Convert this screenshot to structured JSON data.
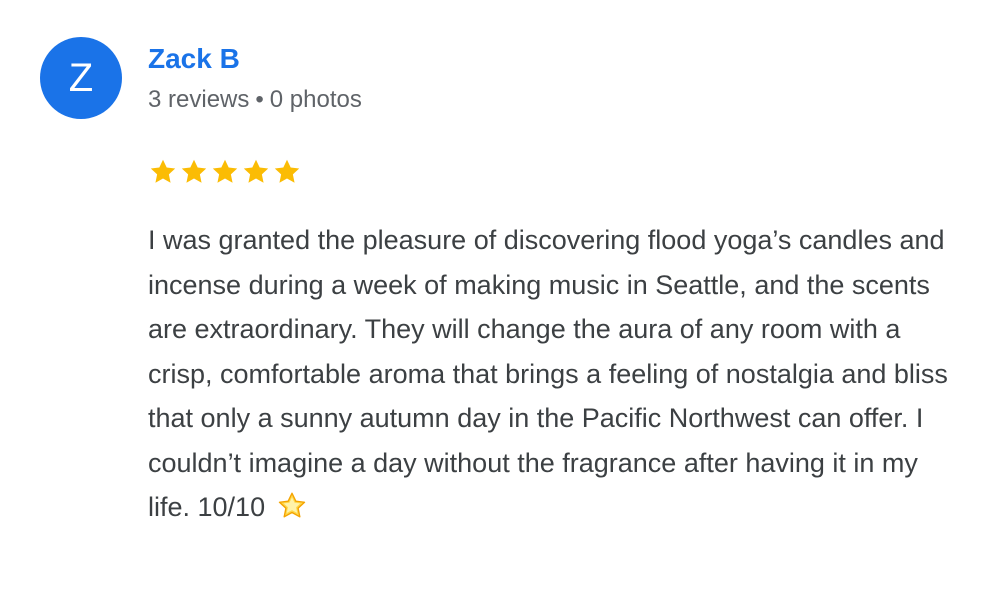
{
  "reviewer": {
    "initial": "Z",
    "name": "Zack B",
    "reviews": "3 reviews",
    "separator": "•",
    "photos": "0 photos"
  },
  "rating": {
    "stars": 5,
    "max": 5,
    "star_color": "#fbbc04",
    "star_icon": "star-icon"
  },
  "review": {
    "text": "I was granted the pleasure of discovering flood yoga’s candles and incense during a week of making music in Seattle, and the scents are extraordinary. They will change the aura of any room with a crisp, comfortable aroma that brings a feeling of nostalgia and bliss that only a sunny autumn day in the Pacific Northwest can offer. I couldn’t imagine a day without the fragrance after having it in my life. 10/10",
    "trailing_icon": "glowing-star-emoji-icon"
  },
  "colors": {
    "avatar_bg": "#1a73e8",
    "name": "#1a73e8",
    "meta": "#5f6368",
    "text": "#3c4043"
  }
}
